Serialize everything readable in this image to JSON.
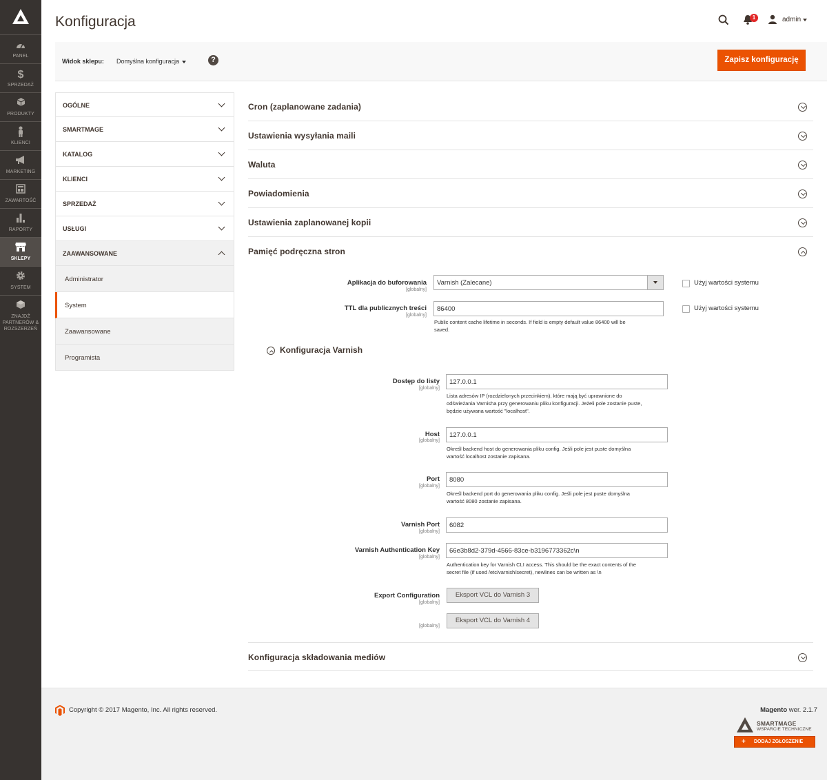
{
  "nav": {
    "items": [
      {
        "label": "PANEL",
        "icon": "dashboard-icon"
      },
      {
        "label": "SPRZEDAŻ",
        "icon": "dollar-icon"
      },
      {
        "label": "PRODUKTY",
        "icon": "box-icon"
      },
      {
        "label": "KLIENCI",
        "icon": "person-icon"
      },
      {
        "label": "MARKETING",
        "icon": "megaphone-icon"
      },
      {
        "label": "ZAWARTOŚĆ",
        "icon": "layout-icon"
      },
      {
        "label": "RAPORTY",
        "icon": "bar-chart-icon"
      },
      {
        "label": "SKLEPY",
        "icon": "store-icon",
        "active": true
      },
      {
        "label": "SYSTEM",
        "icon": "gear-icon"
      },
      {
        "label": "ZNAJDŹ PARTNERÓW & ROZSZERZEŃ",
        "icon": "cube-icon"
      }
    ]
  },
  "header": {
    "title": "Konfiguracja",
    "notifications_count": "1",
    "user_name": "admin"
  },
  "scope": {
    "label": "Widok sklepu:",
    "value": "Domyślna konfiguracja",
    "help": "?",
    "save_label": "Zapisz konfigurację"
  },
  "tabs": [
    {
      "label": "OGÓLNE"
    },
    {
      "label": "SMARTMAGE"
    },
    {
      "label": "KATALOG"
    },
    {
      "label": "KLIENCI"
    },
    {
      "label": "SPRZEDAŻ"
    },
    {
      "label": "USŁUGI"
    },
    {
      "label": "ZAAWANSOWANE",
      "open": true
    }
  ],
  "subtabs": [
    {
      "label": "Administrator"
    },
    {
      "label": "System",
      "current": true
    },
    {
      "label": "Zaawansowane"
    },
    {
      "label": "Programista"
    }
  ],
  "sections": [
    {
      "label": "Cron (zaplanowane zadania)"
    },
    {
      "label": "Ustawienia wysyłania maili"
    },
    {
      "label": "Waluta"
    },
    {
      "label": "Powiadomienia"
    },
    {
      "label": "Ustawienia zaplanowanej kopii"
    },
    {
      "label": "Pamięć podręczna stron",
      "open": true
    },
    {
      "label": "Konfiguracja składowania mediów"
    }
  ],
  "page_cache": {
    "app_label": "Aplikacja do buforowania",
    "app_scope": "[globalny]",
    "app_value": "Varnish (Zalecane)",
    "ttl_label": "TTL dla publicznych treści",
    "ttl_scope": "[globalny]",
    "ttl_value": "86400",
    "ttl_note_1": "Public content cache lifetime in seconds. If field is empty default value 86400 will be",
    "ttl_note_2": "saved.",
    "use_system_1": "Użyj wartości systemu",
    "use_system_2": "Użyj wartości systemu"
  },
  "varnish": {
    "title": "Konfiguracja Varnish",
    "access_label": "Dostęp do listy",
    "access_scope": "[globalny]",
    "access_value": "127.0.0.1",
    "access_note_1": "Lista adresów IP (rozdzielonych przecinkiem), które mają być uprawnione do",
    "access_note_2": "odświeżania Varnisha przy generowaniu pliku konfiguracji. Jeżeli pole zostanie puste,",
    "access_note_3": "będzie używana wartość \"localhost\".",
    "host_label": "Host",
    "host_scope": "[globalny]",
    "host_value": "127.0.0.1",
    "host_note_1": "Określ backend host do generowania pliku config. Jeśli pole jest puste domyślna",
    "host_note_2": "wartość localhost zostanie zapisana.",
    "port_label": "Port",
    "port_scope": "[globalny]",
    "port_value": "8080",
    "port_note_1": "Określ backend port do generowania pliku config. Jeśli pole jest puste domyślna",
    "port_note_2": "wartość 8080 zostanie zapisana.",
    "vport_label": "Varnish Port",
    "vport_scope": "[globalny]",
    "vport_value": "6082",
    "key_label": "Varnish Authentication Key",
    "key_scope": "[globalny]",
    "key_value": "66e3b8d2-379d-4566-83ce-b3196773362c\\n",
    "key_note_1": "Authentication key for Varnish CLI access. This should be the exact contents of the",
    "key_note_2": "secret file (if used /etc/varnish/secret), newlines can be written as \\n",
    "export_label": "Export Configuration",
    "export_scope": "[globalny]",
    "export_btn_3": "Eksport VCL do Varnish 3",
    "export_scope_2": "[globalny]",
    "export_btn_4": "Eksport VCL do Varnish 4"
  },
  "footer": {
    "copyright": "Copyright © 2017 Magento, Inc. All rights reserved.",
    "version_brand": "Magento",
    "version_text": " wer. 2.1.7",
    "sm_brand": "SMARTMAGE",
    "sm_sub": "WSPARCIE TECHNICZNE",
    "sm_button": "DODAJ ZGŁOSZENIE",
    "sm_plus": "+"
  },
  "colors": {
    "accent": "#eb5202",
    "nav_bg": "#373330"
  }
}
